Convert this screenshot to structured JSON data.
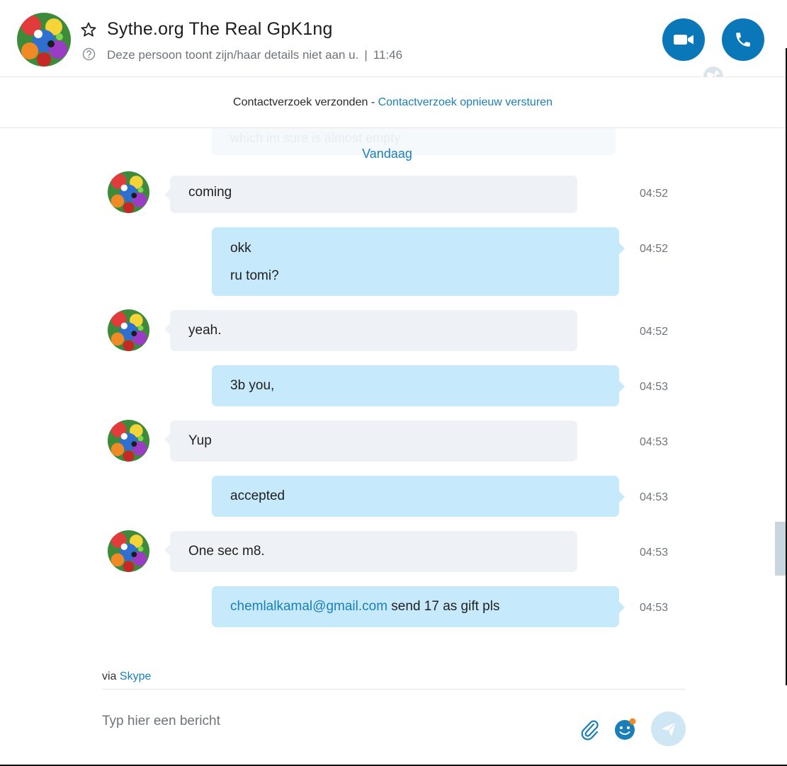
{
  "header": {
    "title": "Sythe.org The Real GpK1ng",
    "status_text": "Deze persoon toont zijn/haar details niet aan u.",
    "separator": "|",
    "time": "11:46",
    "icons": {
      "favorite": "star-icon",
      "info": "question-icon",
      "video": "video-camera-icon",
      "call": "phone-icon",
      "globe": "globe-icon"
    }
  },
  "request_bar": {
    "sent_text": "Contactverzoek verzonden",
    "dash": "-",
    "resend_link": "Contactverzoek opnieuw versturen"
  },
  "chat": {
    "faded_text": "which im sure is almost empty",
    "date_separator": "Vandaag",
    "messages": [
      {
        "sender": "contact",
        "lines": [
          "coming"
        ],
        "time": "04:52"
      },
      {
        "sender": "me",
        "lines": [
          "okk",
          "ru tomi?"
        ],
        "time": "04:52"
      },
      {
        "sender": "contact",
        "lines": [
          "yeah."
        ],
        "time": "04:52"
      },
      {
        "sender": "me",
        "lines": [
          "3b you,"
        ],
        "time": "04:53"
      },
      {
        "sender": "contact",
        "lines": [
          "Yup"
        ],
        "time": "04:53"
      },
      {
        "sender": "me",
        "lines": [
          "accepted"
        ],
        "time": "04:53"
      },
      {
        "sender": "contact",
        "lines": [
          "One sec m8."
        ],
        "time": "04:53"
      },
      {
        "sender": "me",
        "email": "chemlalkamal@gmail.com",
        "rest": " send 17 as gift pls",
        "time": "04:53"
      }
    ]
  },
  "footer": {
    "via_label": "via",
    "via_link": "Skype",
    "composer_placeholder": "Typ hier een bericht",
    "icons": {
      "attach": "paperclip-icon",
      "emoji": "emoji-icon",
      "send": "send-icon"
    }
  },
  "colors": {
    "accent": "#0a78b8",
    "link": "#1a7fb8",
    "incoming_bubble": "#eef1f5",
    "outgoing_bubble": "#c6eafb",
    "emoji_badge": "#f08a24"
  }
}
